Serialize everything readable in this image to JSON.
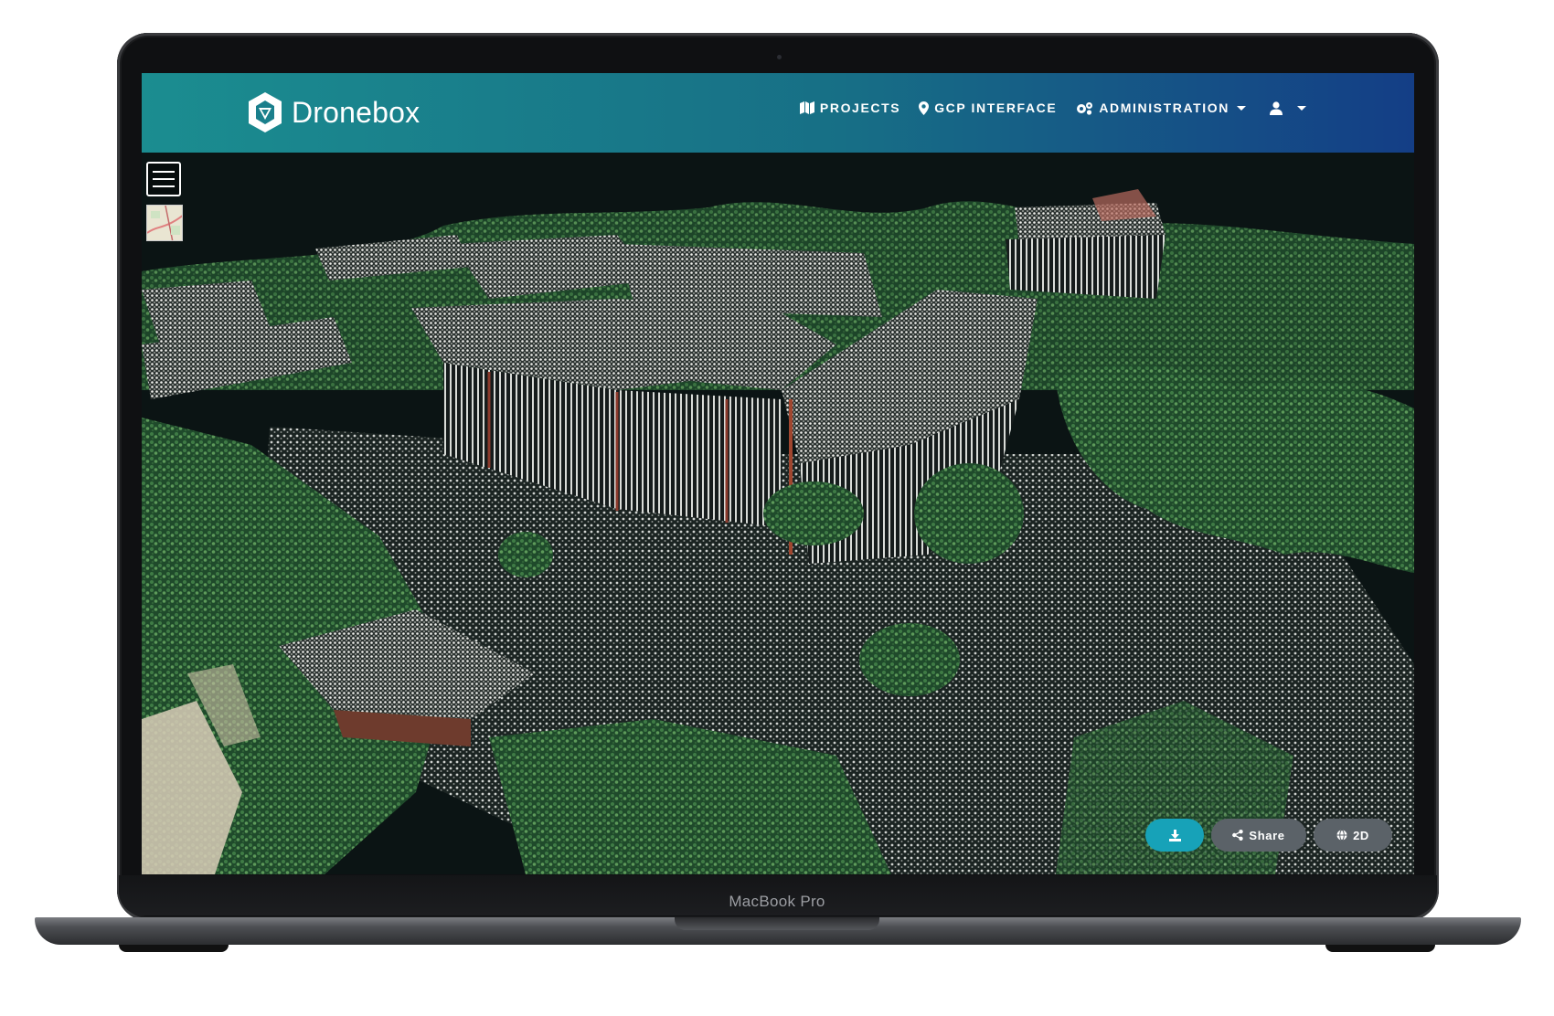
{
  "app": {
    "name": "Dronebox"
  },
  "nav": {
    "projects": "PROJECTS",
    "gcp": "GCP INTERFACE",
    "admin": "ADMINISTRATION"
  },
  "viewer": {
    "share_label": "Share",
    "view2d_label": "2D"
  },
  "device": {
    "model": "MacBook Pro"
  },
  "colors": {
    "navbar_start": "#1b8d90",
    "navbar_end": "#143e86",
    "download_button": "#17a2b8",
    "secondary_button": "#5b6268"
  },
  "icons": {
    "projects": "map-icon",
    "gcp": "map-marker-icon",
    "admin": "cogs-icon",
    "user": "user-icon",
    "download": "download-icon",
    "share": "share-icon",
    "view2d": "globe-icon",
    "menu": "hamburger-menu-icon"
  }
}
